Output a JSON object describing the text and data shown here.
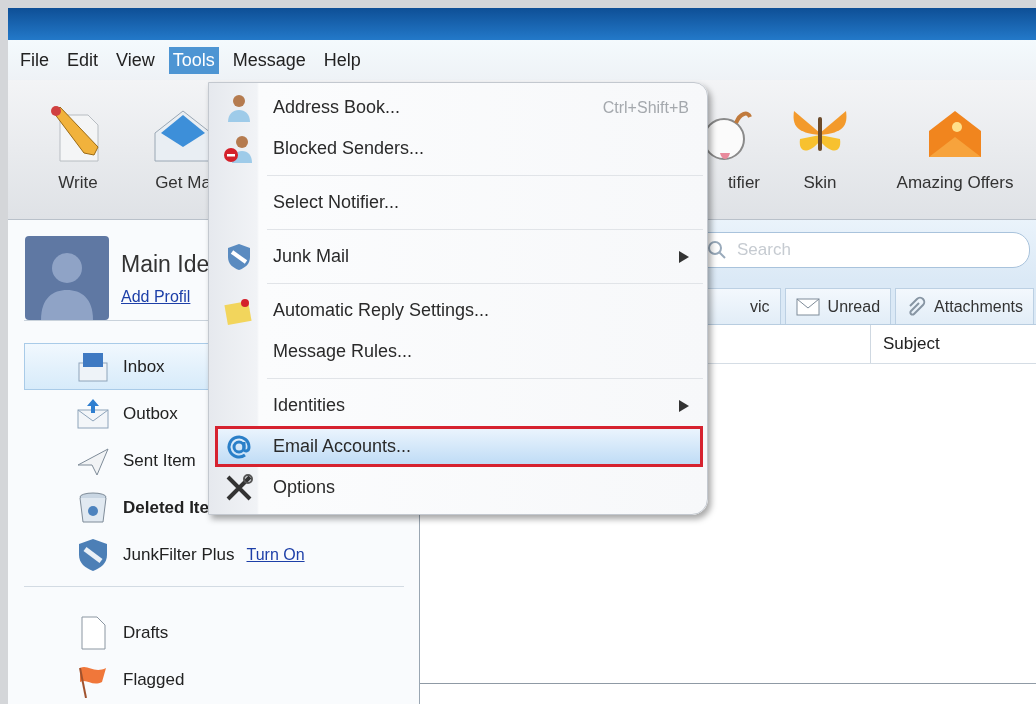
{
  "menu_bar": [
    {
      "label": "File",
      "selected": false
    },
    {
      "label": "Edit",
      "selected": false
    },
    {
      "label": "View",
      "selected": false
    },
    {
      "label": "Tools",
      "selected": true
    },
    {
      "label": "Message",
      "selected": false
    },
    {
      "label": "Help",
      "selected": false
    }
  ],
  "toolbar": [
    {
      "label": "Write"
    },
    {
      "label": "Get Ma"
    },
    {
      "label": "tifier"
    },
    {
      "label": "Skin"
    },
    {
      "label": "Amazing Offers"
    }
  ],
  "tools_menu": {
    "groups": [
      [
        {
          "label": "Address Book...",
          "shortcut": "Ctrl+Shift+B",
          "submenu": false,
          "selected": false
        },
        {
          "label": "Blocked Senders...",
          "submenu": false,
          "selected": false
        }
      ],
      [
        {
          "label": "Select Notifier...",
          "submenu": false,
          "selected": false
        }
      ],
      [
        {
          "label": "Junk Mail",
          "submenu": true,
          "selected": false
        }
      ],
      [
        {
          "label": "Automatic Reply Settings...",
          "submenu": false,
          "selected": false
        },
        {
          "label": "Message Rules...",
          "submenu": false,
          "selected": false
        }
      ],
      [
        {
          "label": "Identities",
          "submenu": true,
          "selected": false
        },
        {
          "label": "Email Accounts...",
          "submenu": false,
          "selected": true
        },
        {
          "label": "Options",
          "submenu": false,
          "selected": false
        }
      ]
    ]
  },
  "profile": {
    "name": "Main Ide",
    "link": "Add Profil"
  },
  "folders": [
    [
      {
        "label": "Inbox",
        "selected": true,
        "unread": false
      },
      {
        "label": "Outbox",
        "selected": false,
        "unread": false
      },
      {
        "label": "Sent Item",
        "selected": false,
        "unread": false
      },
      {
        "label": "Deleted Ite",
        "selected": false,
        "unread": true
      },
      {
        "label": "JunkFilter Plus",
        "link": "Turn On",
        "selected": false,
        "unread": false
      }
    ],
    [
      {
        "label": "Drafts",
        "selected": false,
        "unread": false
      },
      {
        "label": "Flagged",
        "selected": false,
        "unread": false
      }
    ]
  ],
  "search": {
    "placeholder": "Search"
  },
  "filter_tabs": [
    {
      "label": "vic"
    },
    {
      "label": "Unread"
    },
    {
      "label": "Attachments"
    }
  ],
  "message_list": {
    "columns": [
      "Subject"
    ]
  }
}
